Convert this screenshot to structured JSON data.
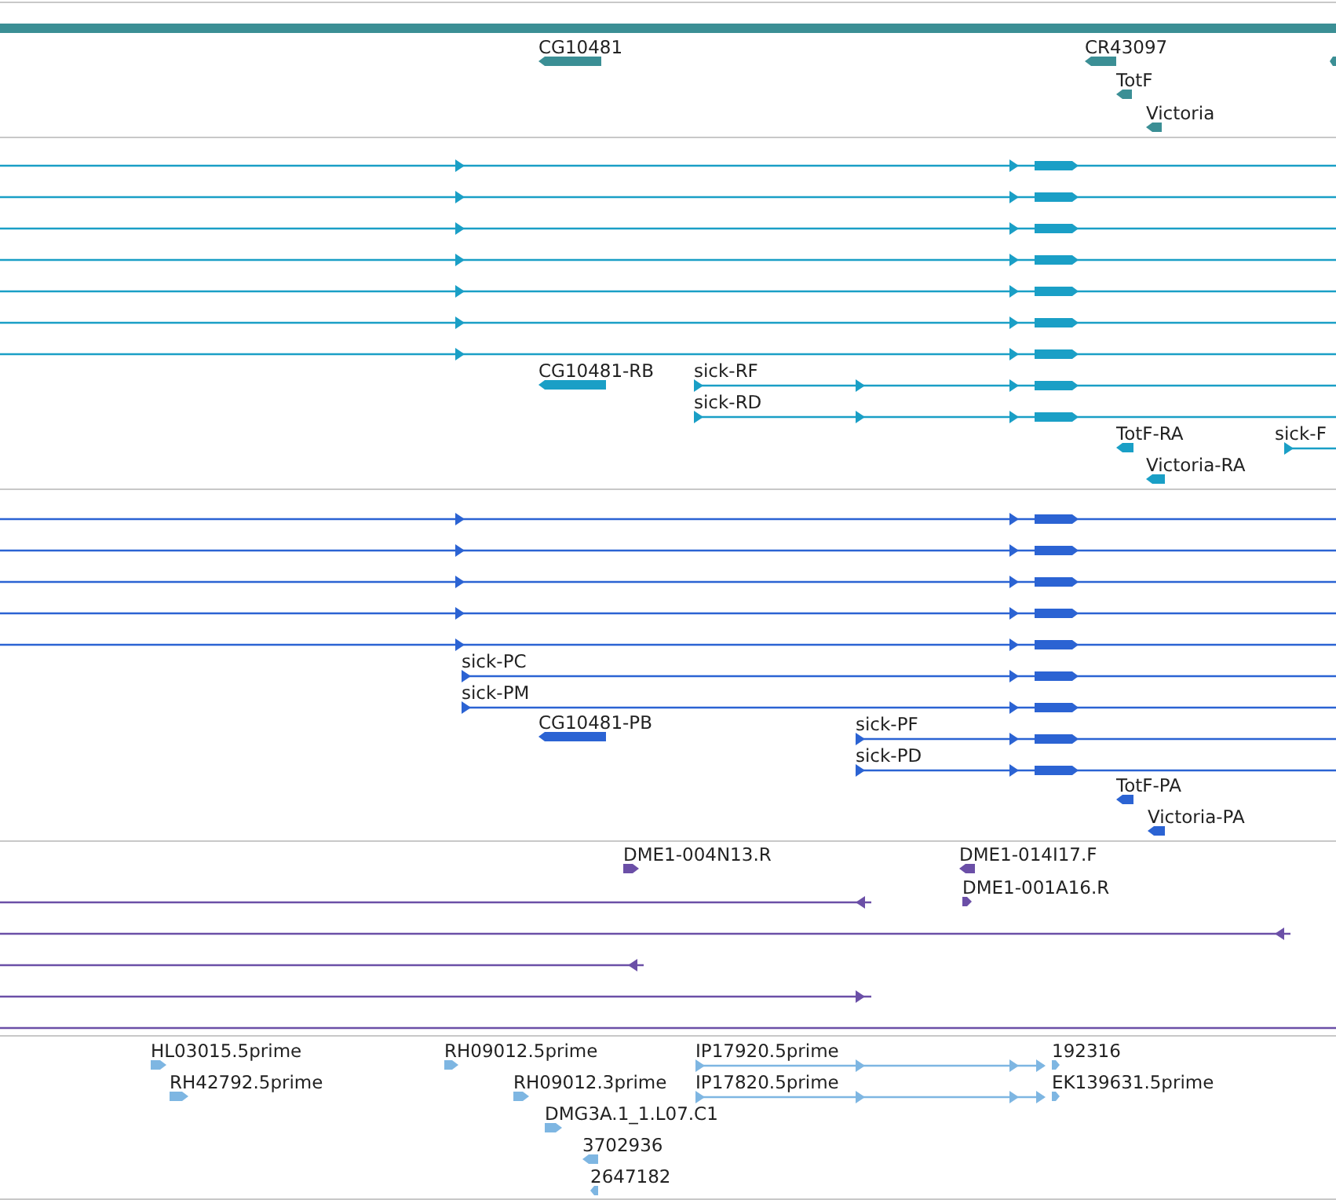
{
  "tracks": [
    {
      "color": "#3b8f95",
      "features": [
        {
          "kind": "bar"
        },
        {
          "kind": "block",
          "label": "CG10481",
          "reverse": true
        },
        {
          "kind": "block",
          "label": "CR43097",
          "reverse": true
        },
        {
          "kind": "block",
          "reverse": true
        },
        {
          "kind": "block",
          "label": "TotF",
          "reverse": true
        },
        {
          "kind": "block",
          "label": "Victoria",
          "reverse": true
        }
      ]
    },
    {
      "color": "#1a9fc6",
      "features": [
        {
          "kind": "transcript",
          "reverse": false
        },
        {
          "kind": "transcript",
          "reverse": false
        },
        {
          "kind": "transcript",
          "reverse": false
        },
        {
          "kind": "transcript",
          "reverse": false
        },
        {
          "kind": "transcript",
          "reverse": false
        },
        {
          "kind": "transcript",
          "reverse": false
        },
        {
          "kind": "transcript",
          "reverse": false
        },
        {
          "kind": "block",
          "label": "CG10481-RB",
          "reverse": true
        },
        {
          "kind": "transcript",
          "label": "sick-RF",
          "reverse": false
        },
        {
          "kind": "transcript",
          "label": "sick-RD",
          "reverse": false
        },
        {
          "kind": "block",
          "label": "TotF-RA",
          "reverse": true
        },
        {
          "kind": "transcript",
          "label": "sick-F",
          "reverse": false
        },
        {
          "kind": "block",
          "label": "Victoria-RA",
          "reverse": true
        }
      ]
    },
    {
      "color": "#2b63d3",
      "features": [
        {
          "kind": "transcript",
          "reverse": false
        },
        {
          "kind": "transcript",
          "reverse": false
        },
        {
          "kind": "transcript",
          "reverse": false
        },
        {
          "kind": "transcript",
          "reverse": false
        },
        {
          "kind": "transcript",
          "reverse": false
        },
        {
          "kind": "transcript",
          "label": "sick-PC",
          "reverse": false
        },
        {
          "kind": "transcript",
          "label": "sick-PM",
          "reverse": false
        },
        {
          "kind": "block",
          "label": "CG10481-PB",
          "reverse": true
        },
        {
          "kind": "transcript",
          "label": "sick-PF",
          "reverse": false
        },
        {
          "kind": "transcript",
          "label": "sick-PD",
          "reverse": false
        },
        {
          "kind": "block",
          "label": "TotF-PA",
          "reverse": true
        },
        {
          "kind": "block",
          "label": "Victoria-PA",
          "reverse": true
        }
      ]
    },
    {
      "color": "#6b4fa7",
      "features": [
        {
          "kind": "block",
          "label": "DME1-004N13.R",
          "reverse": false
        },
        {
          "kind": "block",
          "label": "DME1-014I17.F",
          "reverse": true
        },
        {
          "kind": "block",
          "label": "DME1-001A16.R",
          "reverse": false
        },
        {
          "kind": "line",
          "reverse": true
        },
        {
          "kind": "line",
          "reverse": true
        },
        {
          "kind": "line",
          "reverse": true
        },
        {
          "kind": "line",
          "reverse": false
        },
        {
          "kind": "line"
        }
      ]
    },
    {
      "color": "#7eb6e2",
      "features": [
        {
          "kind": "block",
          "label": "HL03015.5prime",
          "reverse": false
        },
        {
          "kind": "block",
          "label": "RH42792.5prime",
          "reverse": false
        },
        {
          "kind": "block",
          "label": "RH09012.5prime",
          "reverse": false
        },
        {
          "kind": "block",
          "label": "RH09012.3prime",
          "reverse": false
        },
        {
          "kind": "block",
          "label": "DMG3A.1_1.L07.C1",
          "reverse": false
        },
        {
          "kind": "block",
          "label": "3702936",
          "reverse": true
        },
        {
          "kind": "block",
          "label": "2647182",
          "reverse": true
        },
        {
          "kind": "transcript",
          "label": "IP17920.5prime",
          "reverse": false
        },
        {
          "kind": "transcript",
          "label": "IP17820.5prime",
          "reverse": false
        },
        {
          "kind": "block",
          "label": "192316",
          "reverse": false
        },
        {
          "kind": "block",
          "label": "EK139631.5prime",
          "reverse": false
        }
      ]
    }
  ]
}
